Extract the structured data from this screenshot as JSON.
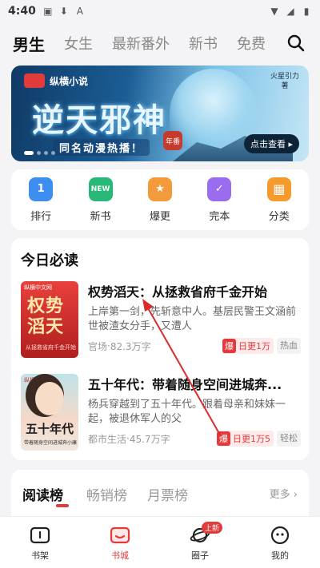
{
  "status_bar": {
    "time": "4:40"
  },
  "top_tabs": [
    {
      "label": "男生",
      "active": true
    },
    {
      "label": "女生"
    },
    {
      "label": "最新番外"
    },
    {
      "label": "新书"
    },
    {
      "label": "免费"
    }
  ],
  "banner": {
    "brand": "纵横小说",
    "title": "逆天邪神",
    "subtitle": "同名动漫热播！",
    "author": "火星引力 著",
    "seal": "年番",
    "cta": "点击查看"
  },
  "quick_nav": [
    {
      "label": "排行",
      "icon": "trophy-icon",
      "color": "#3d8ef0"
    },
    {
      "label": "新书",
      "icon": "new-book-icon",
      "color": "#28b978"
    },
    {
      "label": "爆更",
      "icon": "fire-star-icon",
      "color": "#f39a3b"
    },
    {
      "label": "完本",
      "icon": "completed-book-icon",
      "color": "#9b6cf0"
    },
    {
      "label": "分类",
      "icon": "category-grid-icon",
      "color": "#f59a2c"
    }
  ],
  "today": {
    "title": "今日必读",
    "books": [
      {
        "title": "权势滔天：从拯救省府千金开始",
        "desc": "上岸第一剑，先斩意中人。基层民警王文涵前世被渣女分手，又遭人",
        "category": "官场",
        "words": "82.3万字",
        "hot_label": "爆",
        "update_label": "日更1万",
        "genre": "热血",
        "cover_title": "权势滔天",
        "cover_label": "纵横中文网",
        "cover_sub": "从拯救省府千金开始"
      },
      {
        "title": "五十年代：带着随身空间进城奔...",
        "desc": "杨兵穿越到了五十年代。跟着母亲和妹妹一起，被退休军人的父",
        "category": "都市生活",
        "words": "45.7万字",
        "hot_label": "爆",
        "update_label": "日更1万5",
        "genre": "轻松",
        "cover_title": "五十年代",
        "cover_label": "纵横中文网",
        "cover_sub": "带着随身空间进城奔小康"
      }
    ]
  },
  "ranking": {
    "tabs": [
      "阅读榜",
      "畅销榜",
      "月票榜"
    ],
    "more": "更多"
  },
  "bottom_nav": [
    {
      "label": "书架",
      "icon": "bookshelf-icon"
    },
    {
      "label": "书城",
      "icon": "bookstore-icon",
      "active": true
    },
    {
      "label": "圈子",
      "icon": "planet-icon",
      "badge": "上新"
    },
    {
      "label": "我的",
      "icon": "profile-icon"
    }
  ],
  "colors": {
    "accent": "#e23b3b"
  }
}
